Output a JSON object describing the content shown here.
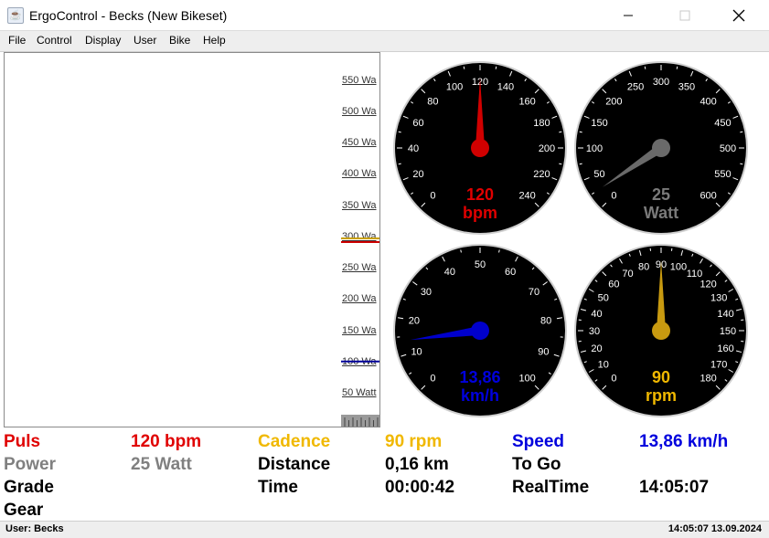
{
  "window": {
    "title": "ErgoControl - Becks (New Bikeset)",
    "icon": "java-icon"
  },
  "menu": [
    "File",
    "Control",
    "Display",
    "User",
    "Bike",
    "Help"
  ],
  "graph": {
    "scale_labels": [
      "550 Wa",
      "500 Wa",
      "450 Wa",
      "400 Wa",
      "350 Wa",
      "300 Wa",
      "250 Wa",
      "200 Wa",
      "150 Wa",
      "100 Wa",
      "50 Watt"
    ],
    "markers": [
      {
        "watt": 300,
        "color": "#c8a000"
      },
      {
        "watt": 300,
        "color": "#cc0000"
      },
      {
        "watt": 100,
        "color": "#000099"
      }
    ]
  },
  "gauges": [
    {
      "name": "pulse",
      "min": 0,
      "max": 240,
      "step": 20,
      "value": 120,
      "value_text": "120",
      "unit": "bpm",
      "color": "#e00000",
      "needle": "#d00000"
    },
    {
      "name": "power",
      "min": 0,
      "max": 600,
      "step": 50,
      "value": 25,
      "value_text": "25",
      "unit": "Watt",
      "color": "#7a7a7a",
      "needle": "#6a6a6a"
    },
    {
      "name": "speed",
      "min": 0,
      "max": 100,
      "step": 10,
      "value": 13.86,
      "value_text": "13,86",
      "unit": "km/h",
      "color": "#0000dd",
      "needle": "#0000cc"
    },
    {
      "name": "cadence",
      "min": 0,
      "max": 180,
      "step": 10,
      "value": 90,
      "value_text": "90",
      "unit": "rpm",
      "color": "#f0b800",
      "needle": "#c89a10"
    }
  ],
  "stats": {
    "puls_label": "Puls",
    "puls_value": "120 bpm",
    "cadence_label": "Cadence",
    "cadence_value": "90 rpm",
    "speed_label": "Speed",
    "speed_value": "13,86 km/h",
    "power_label": "Power",
    "power_value": "25 Watt",
    "distance_label": "Distance",
    "distance_value": "0,16 km",
    "togo_label": "To Go",
    "togo_value": "",
    "grade_label": "Grade",
    "grade_value": "",
    "time_label": "Time",
    "time_value": "00:00:42",
    "realtime_label": "RealTime",
    "realtime_value": "14:05:07",
    "gear_label": "Gear",
    "gear_value": ""
  },
  "colors": {
    "red": "#e00000",
    "gray": "#808080",
    "yellow": "#f0b800",
    "blue": "#0000dd",
    "black": "#000000"
  },
  "status": {
    "user": "User: Becks",
    "datetime": "14:05:07 13.09.2024"
  }
}
